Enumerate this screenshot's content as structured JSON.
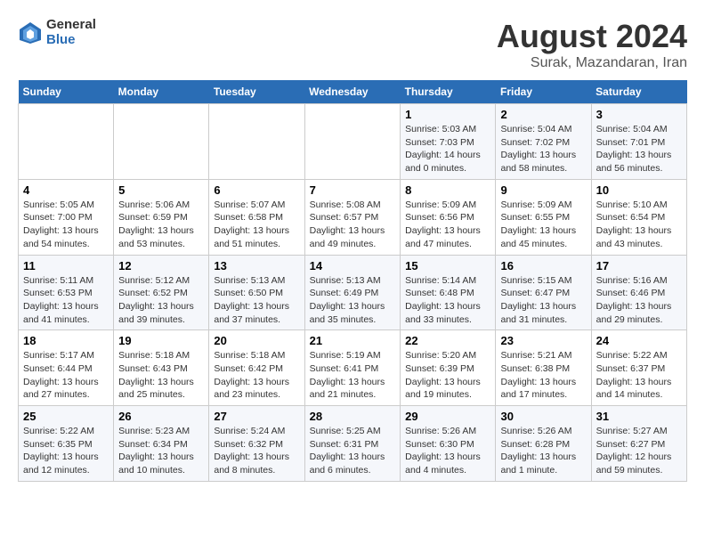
{
  "logo": {
    "general": "General",
    "blue": "Blue"
  },
  "title": "August 2024",
  "subtitle": "Surak, Mazandaran, Iran",
  "days_of_week": [
    "Sunday",
    "Monday",
    "Tuesday",
    "Wednesday",
    "Thursday",
    "Friday",
    "Saturday"
  ],
  "weeks": [
    [
      {
        "day": "",
        "info": ""
      },
      {
        "day": "",
        "info": ""
      },
      {
        "day": "",
        "info": ""
      },
      {
        "day": "",
        "info": ""
      },
      {
        "day": "1",
        "info": "Sunrise: 5:03 AM\nSunset: 7:03 PM\nDaylight: 14 hours and 0 minutes."
      },
      {
        "day": "2",
        "info": "Sunrise: 5:04 AM\nSunset: 7:02 PM\nDaylight: 13 hours and 58 minutes."
      },
      {
        "day": "3",
        "info": "Sunrise: 5:04 AM\nSunset: 7:01 PM\nDaylight: 13 hours and 56 minutes."
      }
    ],
    [
      {
        "day": "4",
        "info": "Sunrise: 5:05 AM\nSunset: 7:00 PM\nDaylight: 13 hours and 54 minutes."
      },
      {
        "day": "5",
        "info": "Sunrise: 5:06 AM\nSunset: 6:59 PM\nDaylight: 13 hours and 53 minutes."
      },
      {
        "day": "6",
        "info": "Sunrise: 5:07 AM\nSunset: 6:58 PM\nDaylight: 13 hours and 51 minutes."
      },
      {
        "day": "7",
        "info": "Sunrise: 5:08 AM\nSunset: 6:57 PM\nDaylight: 13 hours and 49 minutes."
      },
      {
        "day": "8",
        "info": "Sunrise: 5:09 AM\nSunset: 6:56 PM\nDaylight: 13 hours and 47 minutes."
      },
      {
        "day": "9",
        "info": "Sunrise: 5:09 AM\nSunset: 6:55 PM\nDaylight: 13 hours and 45 minutes."
      },
      {
        "day": "10",
        "info": "Sunrise: 5:10 AM\nSunset: 6:54 PM\nDaylight: 13 hours and 43 minutes."
      }
    ],
    [
      {
        "day": "11",
        "info": "Sunrise: 5:11 AM\nSunset: 6:53 PM\nDaylight: 13 hours and 41 minutes."
      },
      {
        "day": "12",
        "info": "Sunrise: 5:12 AM\nSunset: 6:52 PM\nDaylight: 13 hours and 39 minutes."
      },
      {
        "day": "13",
        "info": "Sunrise: 5:13 AM\nSunset: 6:50 PM\nDaylight: 13 hours and 37 minutes."
      },
      {
        "day": "14",
        "info": "Sunrise: 5:13 AM\nSunset: 6:49 PM\nDaylight: 13 hours and 35 minutes."
      },
      {
        "day": "15",
        "info": "Sunrise: 5:14 AM\nSunset: 6:48 PM\nDaylight: 13 hours and 33 minutes."
      },
      {
        "day": "16",
        "info": "Sunrise: 5:15 AM\nSunset: 6:47 PM\nDaylight: 13 hours and 31 minutes."
      },
      {
        "day": "17",
        "info": "Sunrise: 5:16 AM\nSunset: 6:46 PM\nDaylight: 13 hours and 29 minutes."
      }
    ],
    [
      {
        "day": "18",
        "info": "Sunrise: 5:17 AM\nSunset: 6:44 PM\nDaylight: 13 hours and 27 minutes."
      },
      {
        "day": "19",
        "info": "Sunrise: 5:18 AM\nSunset: 6:43 PM\nDaylight: 13 hours and 25 minutes."
      },
      {
        "day": "20",
        "info": "Sunrise: 5:18 AM\nSunset: 6:42 PM\nDaylight: 13 hours and 23 minutes."
      },
      {
        "day": "21",
        "info": "Sunrise: 5:19 AM\nSunset: 6:41 PM\nDaylight: 13 hours and 21 minutes."
      },
      {
        "day": "22",
        "info": "Sunrise: 5:20 AM\nSunset: 6:39 PM\nDaylight: 13 hours and 19 minutes."
      },
      {
        "day": "23",
        "info": "Sunrise: 5:21 AM\nSunset: 6:38 PM\nDaylight: 13 hours and 17 minutes."
      },
      {
        "day": "24",
        "info": "Sunrise: 5:22 AM\nSunset: 6:37 PM\nDaylight: 13 hours and 14 minutes."
      }
    ],
    [
      {
        "day": "25",
        "info": "Sunrise: 5:22 AM\nSunset: 6:35 PM\nDaylight: 13 hours and 12 minutes."
      },
      {
        "day": "26",
        "info": "Sunrise: 5:23 AM\nSunset: 6:34 PM\nDaylight: 13 hours and 10 minutes."
      },
      {
        "day": "27",
        "info": "Sunrise: 5:24 AM\nSunset: 6:32 PM\nDaylight: 13 hours and 8 minutes."
      },
      {
        "day": "28",
        "info": "Sunrise: 5:25 AM\nSunset: 6:31 PM\nDaylight: 13 hours and 6 minutes."
      },
      {
        "day": "29",
        "info": "Sunrise: 5:26 AM\nSunset: 6:30 PM\nDaylight: 13 hours and 4 minutes."
      },
      {
        "day": "30",
        "info": "Sunrise: 5:26 AM\nSunset: 6:28 PM\nDaylight: 13 hours and 1 minute."
      },
      {
        "day": "31",
        "info": "Sunrise: 5:27 AM\nSunset: 6:27 PM\nDaylight: 12 hours and 59 minutes."
      }
    ]
  ]
}
